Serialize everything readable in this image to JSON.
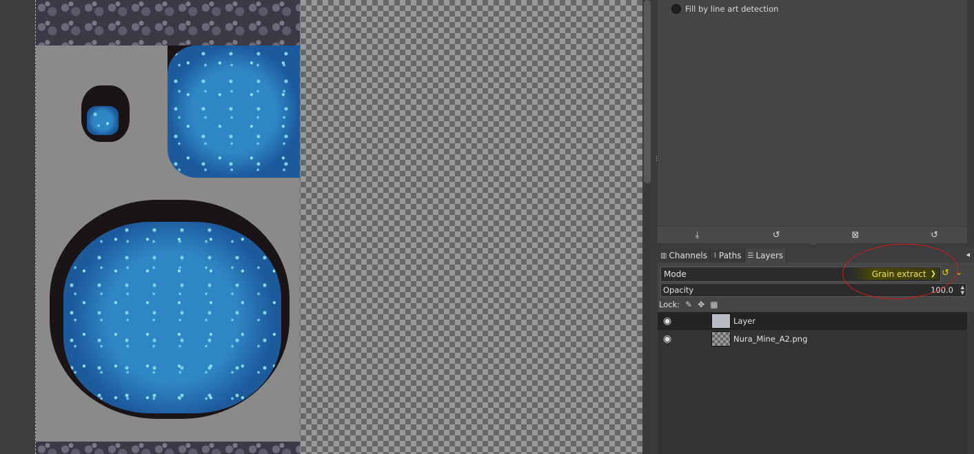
{
  "tool_options": {
    "fill_option_label": "Fill by line art detection",
    "buttons": [
      "⤓",
      "↺",
      "⊠",
      "↺"
    ]
  },
  "dock_tabs": [
    {
      "icon": "channels-icon",
      "label": "Channels"
    },
    {
      "icon": "paths-icon",
      "label": "Paths"
    },
    {
      "icon": "layers-icon",
      "label": "Layers"
    }
  ],
  "layers": {
    "mode_label": "Mode",
    "mode_value": "Grain extract",
    "opacity_label": "Opacity",
    "opacity_value": "100.0",
    "lock_label": "Lock:",
    "items": [
      {
        "name": "Layer",
        "visible": true,
        "thumbnail": "solid"
      },
      {
        "name": "Nura_Mine_A2.png",
        "visible": true,
        "thumbnail": "checker"
      }
    ]
  },
  "colors": {
    "mode_highlight": "#f0e25a",
    "annotation_circle": "#d61a1a",
    "canvas_guide": "#d8c400"
  }
}
